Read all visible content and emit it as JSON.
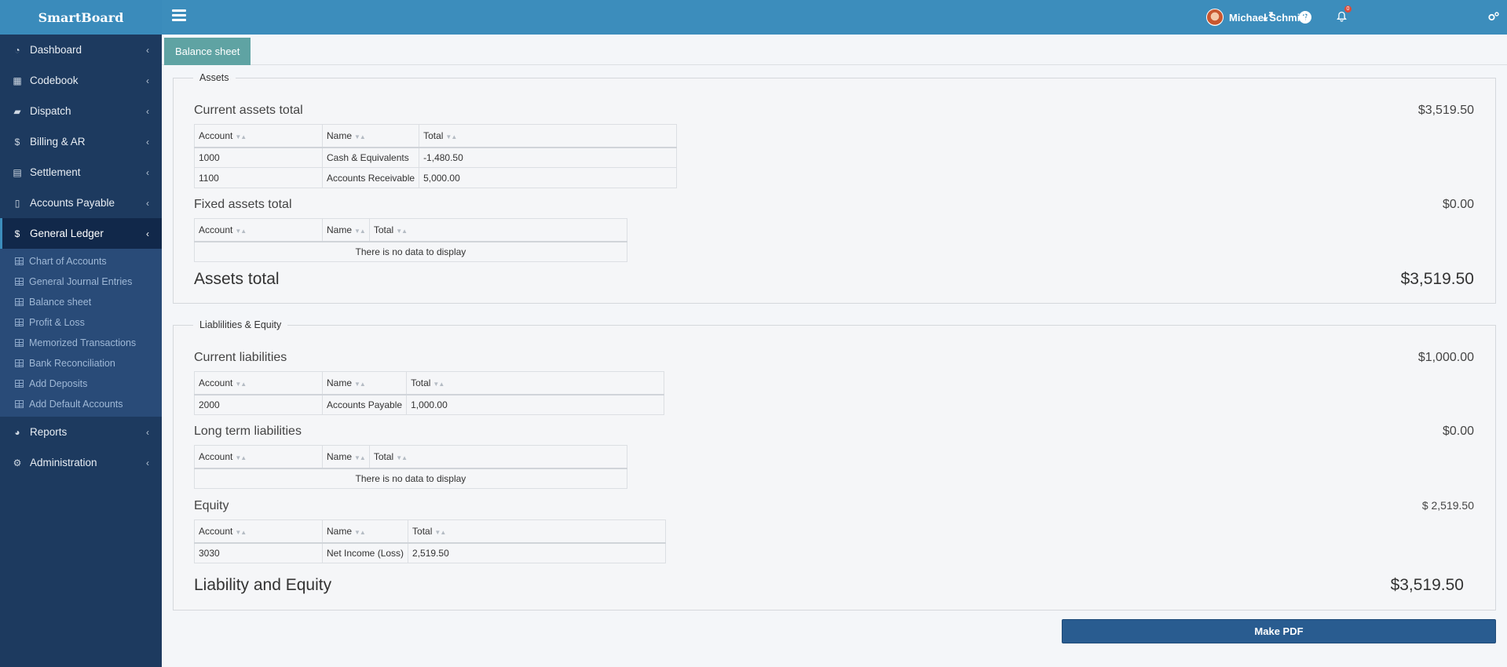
{
  "app": {
    "logo": "SmartBoard"
  },
  "sidebar": {
    "items_top": [
      {
        "label": "Dashboard",
        "icon": "dashboard-icon"
      },
      {
        "label": "Codebook",
        "icon": "grid-icon"
      },
      {
        "label": "Dispatch",
        "icon": "truck-icon"
      },
      {
        "label": "Billing & AR",
        "icon": "dollar-icon"
      },
      {
        "label": "Settlement",
        "icon": "calculator-icon"
      },
      {
        "label": "Accounts Payable",
        "icon": "book-icon"
      },
      {
        "label": "General Ledger",
        "icon": "dollar-icon",
        "active": true
      }
    ],
    "sub_items": [
      {
        "label": "Chart of Accounts"
      },
      {
        "label": "General Journal Entries"
      },
      {
        "label": "Balance sheet"
      },
      {
        "label": "Profit & Loss"
      },
      {
        "label": "Memorized Transactions"
      },
      {
        "label": "Bank Reconciliation"
      },
      {
        "label": "Add Deposits"
      },
      {
        "label": "Add Default Accounts"
      }
    ],
    "items_bottom": [
      {
        "label": "Reports",
        "icon": "pie-chart-icon"
      },
      {
        "label": "Administration",
        "icon": "cogs-icon"
      }
    ]
  },
  "header": {
    "notification_count": "0",
    "user_name": "Michael Schmidt",
    "help_glyph": "?"
  },
  "tabs": {
    "active": "Balance sheet"
  },
  "columns": {
    "account": "Account",
    "name": "Name",
    "total": "Total"
  },
  "empty_text": "There is no data to display",
  "assets": {
    "legend": "Assets",
    "current": {
      "title": "Current assets total",
      "total": "$3,519.50",
      "rows": [
        {
          "account": "1000",
          "name": "Cash & Equivalents",
          "total": "-1,480.50"
        },
        {
          "account": "1100",
          "name": "Accounts Receivable",
          "total": "5,000.00"
        }
      ]
    },
    "fixed": {
      "title": "Fixed assets total",
      "total": "$0.00"
    },
    "grand": {
      "title": "Assets total",
      "total": "$3,519.50"
    }
  },
  "liabilities": {
    "legend": "Liablilities & Equity",
    "current": {
      "title": "Current liabilities",
      "total": "$1,000.00",
      "rows": [
        {
          "account": "2000",
          "name": "Accounts Payable",
          "total": "1,000.00"
        }
      ]
    },
    "long_term": {
      "title": "Long term liabilities",
      "total": "$0.00"
    },
    "equity": {
      "title": "Equity",
      "total": "$ 2,519.50",
      "rows": [
        {
          "account": "3030",
          "name": "Net Income (Loss)",
          "total": "2,519.50"
        }
      ]
    },
    "grand": {
      "title": "Liability and Equity",
      "total": "$3,519.50"
    }
  },
  "actions": {
    "make_pdf": "Make PDF"
  },
  "colors": {
    "sidebar": "#1d3a5f",
    "header": "#3c8dbc",
    "tab": "#5fa3a3",
    "button": "#295c90"
  }
}
